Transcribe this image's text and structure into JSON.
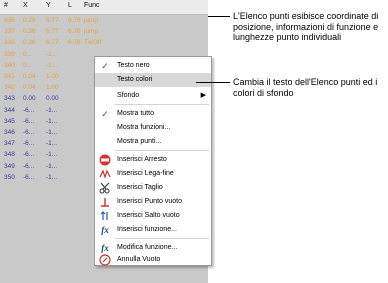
{
  "list": {
    "headers": [
      "#",
      "X",
      "Y",
      "L",
      "Func"
    ],
    "rows": [
      {
        "cells": [
          "336",
          "0.28",
          "6.77",
          "6.78",
          "jump"
        ],
        "color": "#e8a23a"
      },
      {
        "cells": [
          "337",
          "0.28",
          "6.77",
          "6.78",
          "jump"
        ],
        "color": "#e8a23a"
      },
      {
        "cells": [
          "338",
          "0.28",
          "6.77",
          "6.78",
          "TieOff"
        ],
        "color": "#e8a23a"
      },
      {
        "cells": [
          "339",
          "0...",
          "-1...",
          "",
          ""
        ],
        "color": "#e8a23a"
      },
      {
        "cells": [
          "340",
          "0...",
          "-1...",
          "",
          ""
        ],
        "color": "#e8a23a"
      },
      {
        "cells": [
          "341",
          "0.04",
          "1.00",
          "",
          ""
        ],
        "color": "#e8a23a"
      },
      {
        "cells": [
          "342",
          "0.04",
          "1.00",
          "",
          ""
        ],
        "color": "#e8a23a"
      },
      {
        "cells": [
          "343",
          "0.00",
          "0.00",
          "",
          ""
        ],
        "color": "#3a3aa0"
      },
      {
        "cells": [
          "344",
          "-6...",
          "-1...",
          "",
          ""
        ],
        "color": "#3a3aa0"
      },
      {
        "cells": [
          "345",
          "-6...",
          "-1...",
          "",
          ""
        ],
        "color": "#3a3aa0"
      },
      {
        "cells": [
          "346",
          "-6...",
          "-1...",
          "",
          ""
        ],
        "color": "#3a3aa0"
      },
      {
        "cells": [
          "347",
          "-6...",
          "-1...",
          "",
          ""
        ],
        "color": "#3a3aa0"
      },
      {
        "cells": [
          "348",
          "-6...",
          "-1...",
          "",
          ""
        ],
        "color": "#3a3aa0"
      },
      {
        "cells": [
          "349",
          "-6...",
          "-1...",
          "",
          ""
        ],
        "color": "#3a3aa0"
      },
      {
        "cells": [
          "350",
          "-6...",
          "-1...",
          "",
          ""
        ],
        "color": "#3a3aa0"
      }
    ]
  },
  "menu": {
    "items": [
      {
        "label": "Testo nero",
        "checked": true
      },
      {
        "label": "Testo colori",
        "highlight": true
      },
      {
        "label": "Sfondo",
        "submenu": true
      },
      {
        "label": "Mostra tutto",
        "checked": true
      },
      {
        "label": "Mostra funzioni..."
      },
      {
        "label": "Mostra punti..."
      },
      {
        "label": "Inserisci Arresto",
        "icon": "stop-icon"
      },
      {
        "label": "Inserisci Lega-fine",
        "icon": "tie-off-icon"
      },
      {
        "label": "Inserisci Taglio",
        "icon": "trim-icon"
      },
      {
        "label": "Inserisci Punto vuoto",
        "icon": "empty-stitch-icon"
      },
      {
        "label": "Inserisci Salto vuoto",
        "icon": "empty-jump-icon"
      },
      {
        "label": "Inserisci funzione...",
        "icon": "insert-function-icon"
      },
      {
        "label": "Modifica funzione...",
        "icon": "edit-function-icon"
      },
      {
        "label": "Annulla Vuoto",
        "icon": "cancel-empty-icon"
      }
    ]
  },
  "annotations": {
    "note1": "L'Elenco punti esibisce coordinate di posizione, informazioni di funzione e lunghezze punto individuali",
    "note2": "Cambia il testo dell'Elenco punti ed i colori di sfondo"
  }
}
